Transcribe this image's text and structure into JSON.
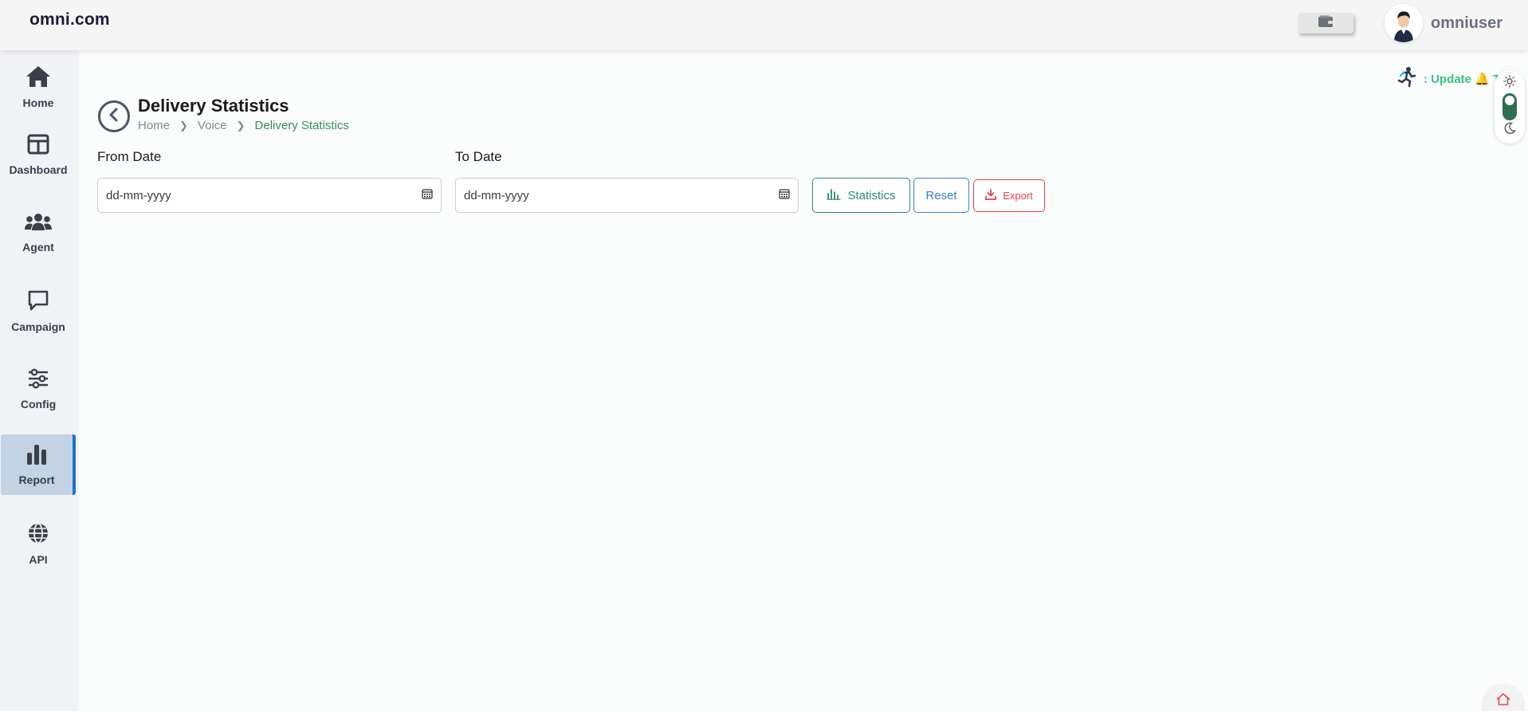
{
  "header": {
    "brand": "omni.com",
    "username": "omniuser"
  },
  "sidebar": {
    "items": [
      {
        "label": "Home",
        "icon": "home-icon"
      },
      {
        "label": "Dashboard",
        "icon": "dashboard-icon"
      },
      {
        "label": "Agent",
        "icon": "agent-icon"
      },
      {
        "label": "Campaign",
        "icon": "campaign-icon"
      },
      {
        "label": "Config",
        "icon": "config-icon"
      },
      {
        "label": "Report",
        "icon": "report-icon",
        "active": true
      },
      {
        "label": "API",
        "icon": "globe-icon"
      }
    ]
  },
  "notice": {
    "text": ": Update 🔔 T"
  },
  "page": {
    "title": "Delivery Statistics",
    "breadcrumb": [
      "Home",
      "Voice",
      "Delivery Statistics"
    ]
  },
  "filters": {
    "from_label": "From Date",
    "from_placeholder": "dd-mm-yyyy",
    "to_label": "To Date",
    "to_placeholder": "dd-mm-yyyy"
  },
  "actions": {
    "statistics": "Statistics",
    "reset": "Reset",
    "export": "Export"
  },
  "colors": {
    "accent_green": "#2f8a63",
    "accent_blue": "#3b7fc6",
    "accent_red": "#e2404b",
    "active_nav_bg": "#c3d3e4",
    "active_nav_border": "#1e74c9"
  }
}
